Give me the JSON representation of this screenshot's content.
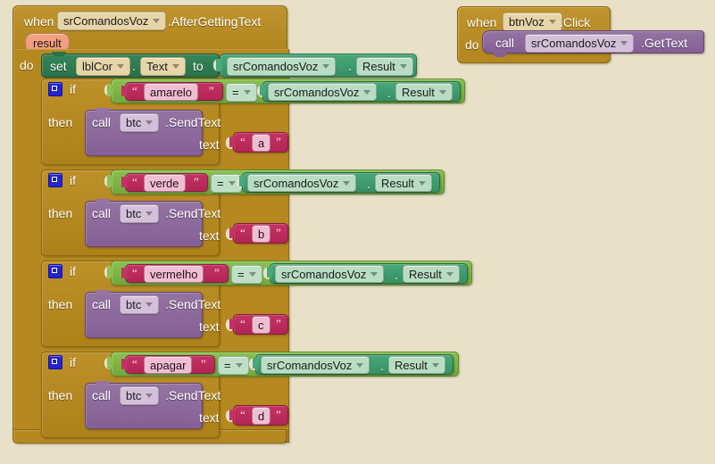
{
  "editor": {
    "name": "MIT App Inventor Blocks Editor",
    "background_color": "#e9e0c8"
  },
  "palette": {
    "event_gold": "#b5891f",
    "control_gold": "#b5891f",
    "setter_green": "#2e7a52",
    "getter_green": "#3d9b6d",
    "logic_green": "#7cb342",
    "call_purple": "#8d6a9c",
    "text_crimson": "#bd2a5d",
    "param_peach": "#f0a080",
    "mutator_blue": "#2323d0"
  },
  "blocks": {
    "event_speech": {
      "when_label": "when",
      "component": "srComandosVoz",
      "event": ".AfterGettingText",
      "param": "result",
      "do_label": "do"
    },
    "setter": {
      "set_label": "set",
      "component": "lblCor",
      "dot": ".",
      "property": "Text",
      "to_label": "to",
      "value": {
        "component": "srComandosVoz",
        "dot": ".",
        "property": "Result"
      }
    },
    "conditions": [
      {
        "if_label": "if",
        "then_label": "then",
        "text_value": "amarelo",
        "operator": "=",
        "right": {
          "component": "srComandosVoz",
          "dot": ".",
          "property": "Result"
        },
        "call_label": "call",
        "call_component": "btc",
        "call_method": ".SendText",
        "arg_label": "text",
        "arg_value": "a"
      },
      {
        "if_label": "if",
        "then_label": "then",
        "text_value": "verde",
        "operator": "=",
        "right": {
          "component": "srComandosVoz",
          "dot": ".",
          "property": "Result"
        },
        "call_label": "call",
        "call_component": "btc",
        "call_method": ".SendText",
        "arg_label": "text",
        "arg_value": "b"
      },
      {
        "if_label": "if",
        "then_label": "then",
        "text_value": "vermelho",
        "operator": "=",
        "right": {
          "component": "srComandosVoz",
          "dot": ".",
          "property": "Result"
        },
        "call_label": "call",
        "call_component": "btc",
        "call_method": ".SendText",
        "arg_label": "text",
        "arg_value": "c"
      },
      {
        "if_label": "if",
        "then_label": "then",
        "text_value": "apagar",
        "operator": "=",
        "right": {
          "component": "srComandosVoz",
          "dot": ".",
          "property": "Result"
        },
        "call_label": "call",
        "call_component": "btc",
        "call_method": ".SendText",
        "arg_label": "text",
        "arg_value": "d"
      }
    ],
    "event_button": {
      "when_label": "when",
      "component": "btnVoz",
      "event": ".Click",
      "do_label": "do",
      "call_label": "call",
      "call_component": "srComandosVoz",
      "call_method": ".GetText"
    }
  },
  "quotes": {
    "open": "“",
    "close": "”"
  }
}
